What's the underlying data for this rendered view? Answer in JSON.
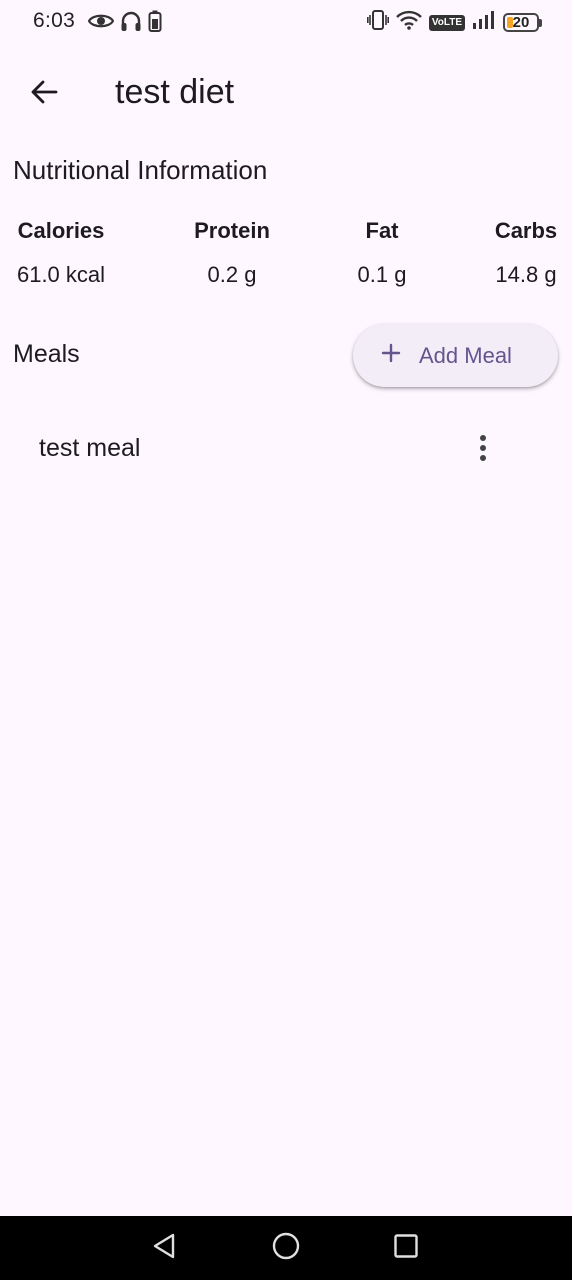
{
  "status_bar": {
    "time": "6:03",
    "battery_level": "20",
    "network_badge": "VoLTE",
    "left_icons": [
      "eye-icon",
      "headphones-icon",
      "battery-saver-icon"
    ],
    "right_icons": [
      "vibrate-icon",
      "wifi-icon",
      "volte-icon",
      "signal-icon",
      "battery-icon"
    ]
  },
  "app_bar": {
    "title": "test diet",
    "back_icon": "arrow-left-icon"
  },
  "nutrition": {
    "heading": "Nutritional Information",
    "items": [
      {
        "label": "Calories",
        "value": "61.0 kcal"
      },
      {
        "label": "Protein",
        "value": "0.2 g"
      },
      {
        "label": "Fat",
        "value": "0.1 g"
      },
      {
        "label": "Carbs",
        "value": "14.8 g"
      }
    ]
  },
  "meals": {
    "heading": "Meals",
    "add_button_label": "Add Meal",
    "items": [
      {
        "name": "test meal",
        "menu_icon": "more-vertical-icon"
      }
    ]
  },
  "colors": {
    "background": "#fef7ff",
    "accent": "#65558f",
    "button_surface": "#f3edf7",
    "battery_fill": "#f5a623"
  },
  "nav_bar": {
    "icons": [
      "back-triangle-icon",
      "home-circle-icon",
      "recents-square-icon"
    ]
  }
}
